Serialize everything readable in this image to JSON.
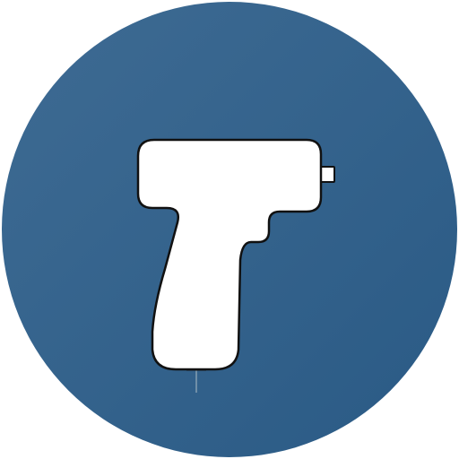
{
  "icon": {
    "name": "piercing-gun-icon",
    "colors": {
      "background_light": "#3e6b93",
      "background_dark": "#2a5a85",
      "tool_fill": "#ffffff",
      "tool_outline": "#111111",
      "cord": "#6f8fa8"
    }
  }
}
